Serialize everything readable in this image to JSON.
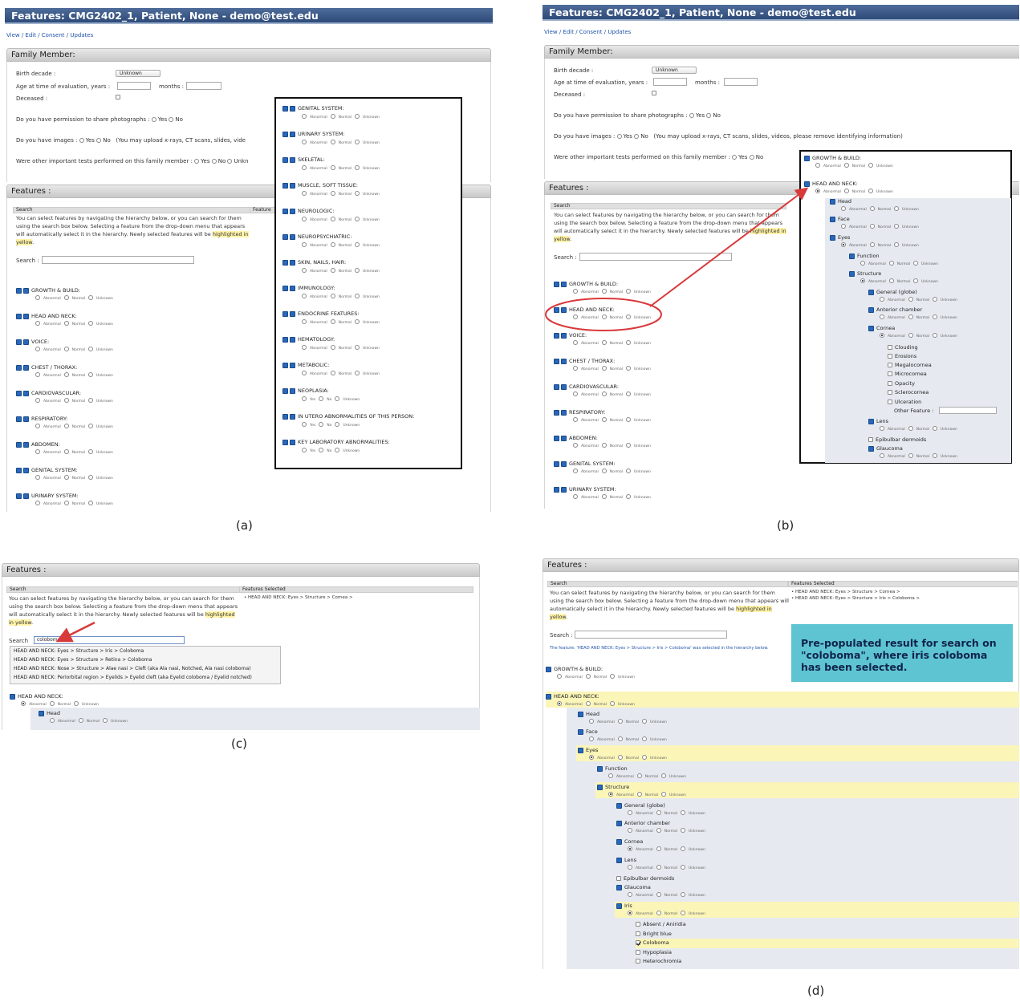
{
  "window_title": "Features: CMG2402_1, Patient, None - demo@test.edu",
  "nav_links": "View / Edit / Consent / Updates",
  "family_member": {
    "heading": "Family Member:",
    "birth_decade_label": "Birth decade :",
    "birth_decade_value": "Unknown",
    "age_label": "Age at time of evaluation, years :",
    "months_label": "months :",
    "deceased_label": "Deceased :",
    "photos_q": "Do you have permission to share photographs :",
    "images_q": "Do you have images :",
    "images_note_short": "(You may upload x-rays, CT scans, slides, vide",
    "images_note_full": "(You may upload x-rays, CT scans, slides, videos, please remove identifying information)",
    "tests_q": "Were other important tests performed on this family member :",
    "yes": "Yes",
    "no": "No",
    "unknown_short": "Unkn"
  },
  "features": {
    "heading": "Features :",
    "search_header": "Search",
    "features_header_short": "Feature",
    "features_selected_header": "Features Selected",
    "instructions_1": "You can select features by navigating the hierarchy below, or you can search for them using the search box below. Selecting a feature from the drop-down menu that appears will automatically select it in the hierarchy. Newly selected features will be ",
    "instructions_hl": "highlighted in yellow",
    "instructions_end": ".",
    "search_label": "Search :",
    "search_value_c": "coloboma",
    "selected_c": "HEAD AND NECK: Eyes > Structure > Cornea >",
    "selected_d_1": "HEAD AND NECK: Eyes > Structure > Cornea >",
    "selected_d_2": "HEAD AND NECK: Eyes > Structure > Iris > Coloboma >",
    "status_d": "The feature: 'HEAD AND NECK: Eyes > Structure > Iris > Coloboma' was selected in the hierarchy below."
  },
  "option_labels": {
    "abnormal": "Abnormal",
    "normal": "Normal",
    "unknown": "Unknown",
    "yes": "Yes",
    "no": "No"
  },
  "categories_a": [
    "GROWTH & BUILD:",
    "HEAD AND NECK:",
    "VOICE:",
    "CHEST / THORAX:",
    "CARDIOVASCULAR:",
    "RESPIRATORY:",
    "ABDOMEN:",
    "GENITAL SYSTEM:",
    "URINARY SYSTEM:"
  ],
  "categories_a_box": [
    "GENITAL SYSTEM:",
    "URINARY SYSTEM:",
    "SKELETAL:",
    "MUSCLE, SOFT TISSUE:",
    "NEUROLOGIC:",
    "NEUROPSYCHIATRIC:",
    "SKIN, NAILS, HAIR:",
    "IMMUNOLOGY:",
    "ENDOCRINE FEATURES:",
    "HEMATOLOGY:",
    "METABOLIC:",
    "NEOPLASIA:",
    "IN UTERO ABNORMALITIES OF THIS PERSON:",
    "KEY LABORATORY ABNORMALITIES:"
  ],
  "categories_b": [
    "GROWTH & BUILD:",
    "HEAD AND NECK:",
    "VOICE:",
    "CHEST / THORAX:",
    "CARDIOVASCULAR:",
    "RESPIRATORY:",
    "ABDOMEN:",
    "GENITAL SYSTEM:",
    "URINARY SYSTEM:"
  ],
  "tree_b": [
    "GROWTH & BUILD:",
    "HEAD AND NECK:",
    "Head",
    "Face",
    "Eyes",
    "Function",
    "Structure",
    "General (globe)",
    "Anterior chamber",
    "Cornea",
    "Clouding",
    "Erosions",
    "Megalocornea",
    "Microcornea",
    "Opacity",
    "Sclerocornea",
    "Ulceration",
    "Other Feature :",
    "Lens",
    "Epibulbar dermoids",
    "Glaucoma"
  ],
  "dropdown_c": [
    "HEAD AND NECK: Eyes > Structure > Iris > Coloboma",
    "HEAD AND NECK: Eyes > Structure > Retina > Coloboma",
    "HEAD AND NECK: Nose > Structure > Alae nasi > Cleft (aka Ala nasi, Notched, Ala nasi coloboma)",
    "HEAD AND NECK: Periorbital region > Eyelids > Eyelid cleft (aka Eyelid coloboma / Eyelid notched)"
  ],
  "tree_c": [
    "HEAD AND NECK:",
    "Head"
  ],
  "tree_d": [
    "GROWTH & BUILD:",
    "HEAD AND NECK:",
    "Head",
    "Face",
    "Eyes",
    "Function",
    "Structure",
    "General (globe)",
    "Anterior chamber",
    "Cornea",
    "Lens",
    "Epibulbar dermoids",
    "Glaucoma",
    "Iris",
    "Absent / Aniridia",
    "Bright blue",
    "Coloboma",
    "Hypoplasia",
    "Heterochromia"
  ],
  "callout_d": "Pre-populated result for search on \"coloboma\", where iris coloboma has been selected.",
  "captions": [
    "(a)",
    "(b)",
    "(c)",
    "(d)"
  ],
  "colors": {
    "title_bar": "#2e4a78",
    "highlight_yellow": "#fbf5b8",
    "callout_bg": "#5ec4d2",
    "annotation_red": "#d9393b",
    "checkbox_blue": "#2a67b8"
  }
}
